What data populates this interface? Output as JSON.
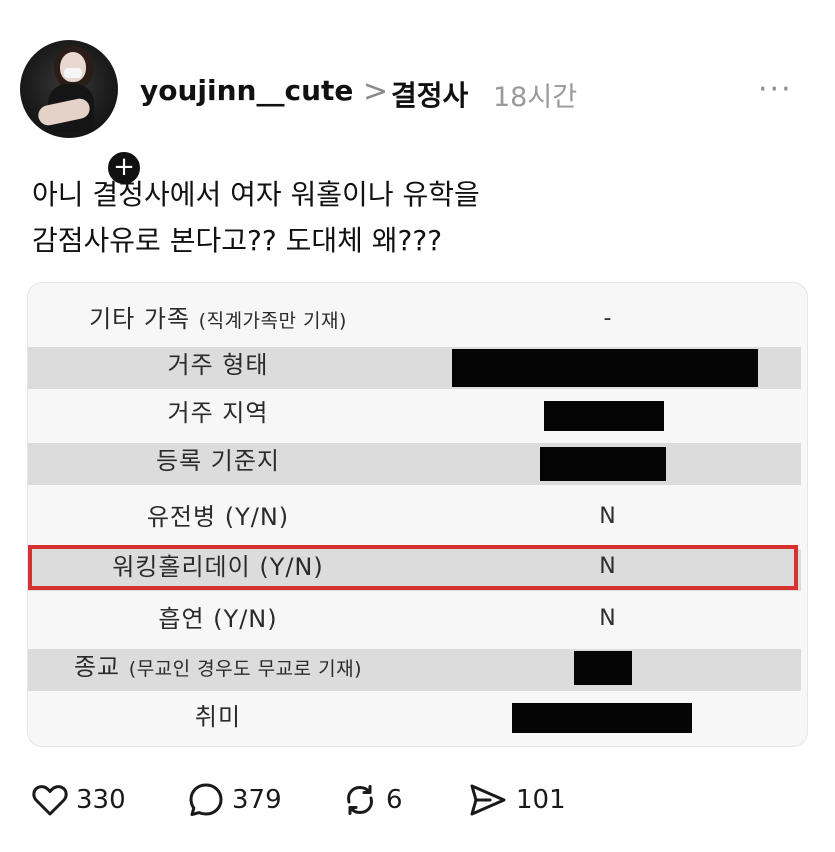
{
  "post": {
    "username": "youjinn__cute",
    "chevron": ">",
    "community": "결정사",
    "time": "18시간",
    "more_label": "···",
    "follow_label": "+",
    "text_lines": [
      "아니 결정사에서 여자 워홀이나 유학을",
      "감점사유로 본다고?? 도대체 왜???"
    ]
  },
  "form": {
    "rows": [
      {
        "label": "기타 가족",
        "sub": "(직계가족만 기재)",
        "value": "-",
        "shaded": false
      },
      {
        "label": "거주 형태",
        "sub": "",
        "value": "",
        "shaded": true
      },
      {
        "label": "거주 지역",
        "sub": "",
        "value": "",
        "shaded": false
      },
      {
        "label": "등록 기준지",
        "sub": "",
        "value": "",
        "shaded": true
      },
      {
        "label": "유전병 (Y/N)",
        "sub": "",
        "value": "N",
        "shaded": false
      },
      {
        "label": "워킹홀리데이 (Y/N)",
        "sub": "",
        "value": "N",
        "shaded": true
      },
      {
        "label": "흡연 (Y/N)",
        "sub": "",
        "value": "N",
        "shaded": false
      },
      {
        "label": "종교",
        "sub": "(무교인 경우도 무교로 기재)",
        "value": "",
        "shaded": true
      },
      {
        "label": "취미",
        "sub": "",
        "value": "",
        "shaded": false
      }
    ],
    "highlight_color": "#d4312f",
    "redacted_color": "#050505"
  },
  "actions": {
    "likes": "330",
    "comments": "379",
    "reposts": "6",
    "shares": "101"
  },
  "icons": {
    "like": "heart-icon",
    "comment": "comment-bubble-icon",
    "repost": "repost-arrows-icon",
    "share": "send-icon",
    "more": "more-dots-icon"
  }
}
